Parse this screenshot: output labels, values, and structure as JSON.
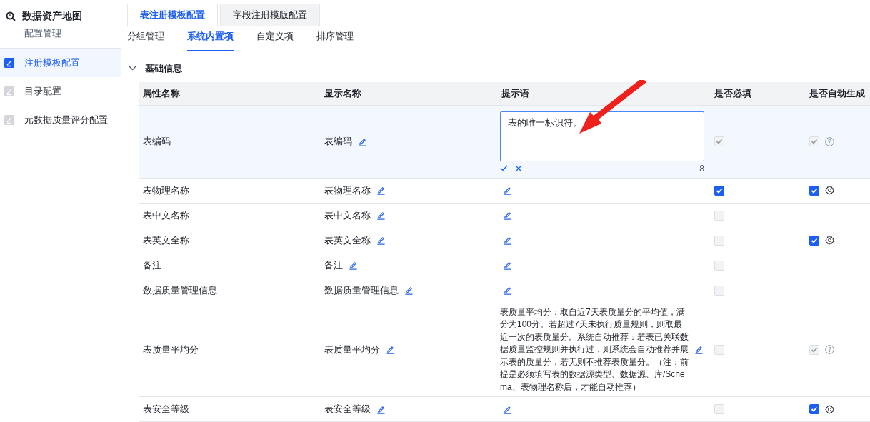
{
  "sidebar": {
    "title": "数据资产地图",
    "subtitle": "配置管理",
    "items": [
      {
        "label": "注册模板配置",
        "selected": true
      },
      {
        "label": "目录配置",
        "selected": false
      },
      {
        "label": "元数据质量评分配置",
        "selected": false
      }
    ]
  },
  "tabs": [
    {
      "label": "表注册模板配置",
      "selected": true
    },
    {
      "label": "字段注册模版配置",
      "selected": false
    }
  ],
  "subtabs": [
    {
      "label": "分组管理",
      "selected": false
    },
    {
      "label": "系统内置项",
      "selected": true
    },
    {
      "label": "自定义项",
      "selected": false
    },
    {
      "label": "排序管理",
      "selected": false
    }
  ],
  "section": {
    "title": "基础信息",
    "expanded": true
  },
  "table": {
    "columns": [
      "属性名称",
      "显示名称",
      "提示语",
      "是否必填",
      "是否自动生成"
    ],
    "rows": [
      {
        "name": "表编码",
        "display": "表编码",
        "editing": true,
        "hint": "表的唯一标识符。",
        "count": "8",
        "required": {
          "checked": true,
          "disabled": true
        },
        "auto": {
          "kind": "checkbox_help",
          "checked": true,
          "disabled": true
        }
      },
      {
        "name": "表物理名称",
        "display": "表物理名称",
        "editing": false,
        "required": {
          "checked": true,
          "disabled": false
        },
        "auto": {
          "kind": "checkbox_gear",
          "checked": true,
          "disabled": false
        }
      },
      {
        "name": "表中文名称",
        "display": "表中文名称",
        "editing": false,
        "required": {
          "checked": false,
          "disabled": true
        },
        "auto": {
          "kind": "dash",
          "text": "–"
        }
      },
      {
        "name": "表英文全称",
        "display": "表英文全称",
        "editing": false,
        "required": {
          "checked": false,
          "disabled": true
        },
        "auto": {
          "kind": "checkbox_gear",
          "checked": true,
          "disabled": false
        }
      },
      {
        "name": "备注",
        "display": "备注",
        "editing": false,
        "required": {
          "checked": false,
          "disabled": true
        },
        "auto": {
          "kind": "dash",
          "text": "–"
        }
      },
      {
        "name": "数据质量管理信息",
        "display": "数据质量管理信息",
        "editing": false,
        "required": {
          "checked": false,
          "disabled": true
        },
        "auto": {
          "kind": "dash",
          "text": "–"
        }
      },
      {
        "name": "表质量平均分",
        "display": "表质量平均分",
        "editing": false,
        "hint": "表质量平均分：取自近7天表质量分的平均值，满分为100分。若超过7天未执行质量规则，则取最近一次的表质量分。系统自动推荐：若表已关联数据质量监控规则并执行过，则系统会自动推荐并展示表的质量分，若无则不推荐表质量分。（注：前提是必须填写表的数据源类型、数据源、库/Schema、表物理名称后，才能自动推荐）",
        "required": {
          "checked": false,
          "disabled": true
        },
        "auto": {
          "kind": "checkbox_help",
          "checked": true,
          "disabled": true
        }
      },
      {
        "name": "表安全等级",
        "display": "表安全等级",
        "editing": false,
        "required": {
          "checked": false,
          "disabled": true
        },
        "auto": {
          "kind": "checkbox_gear",
          "checked": true,
          "disabled": false
        }
      }
    ]
  }
}
